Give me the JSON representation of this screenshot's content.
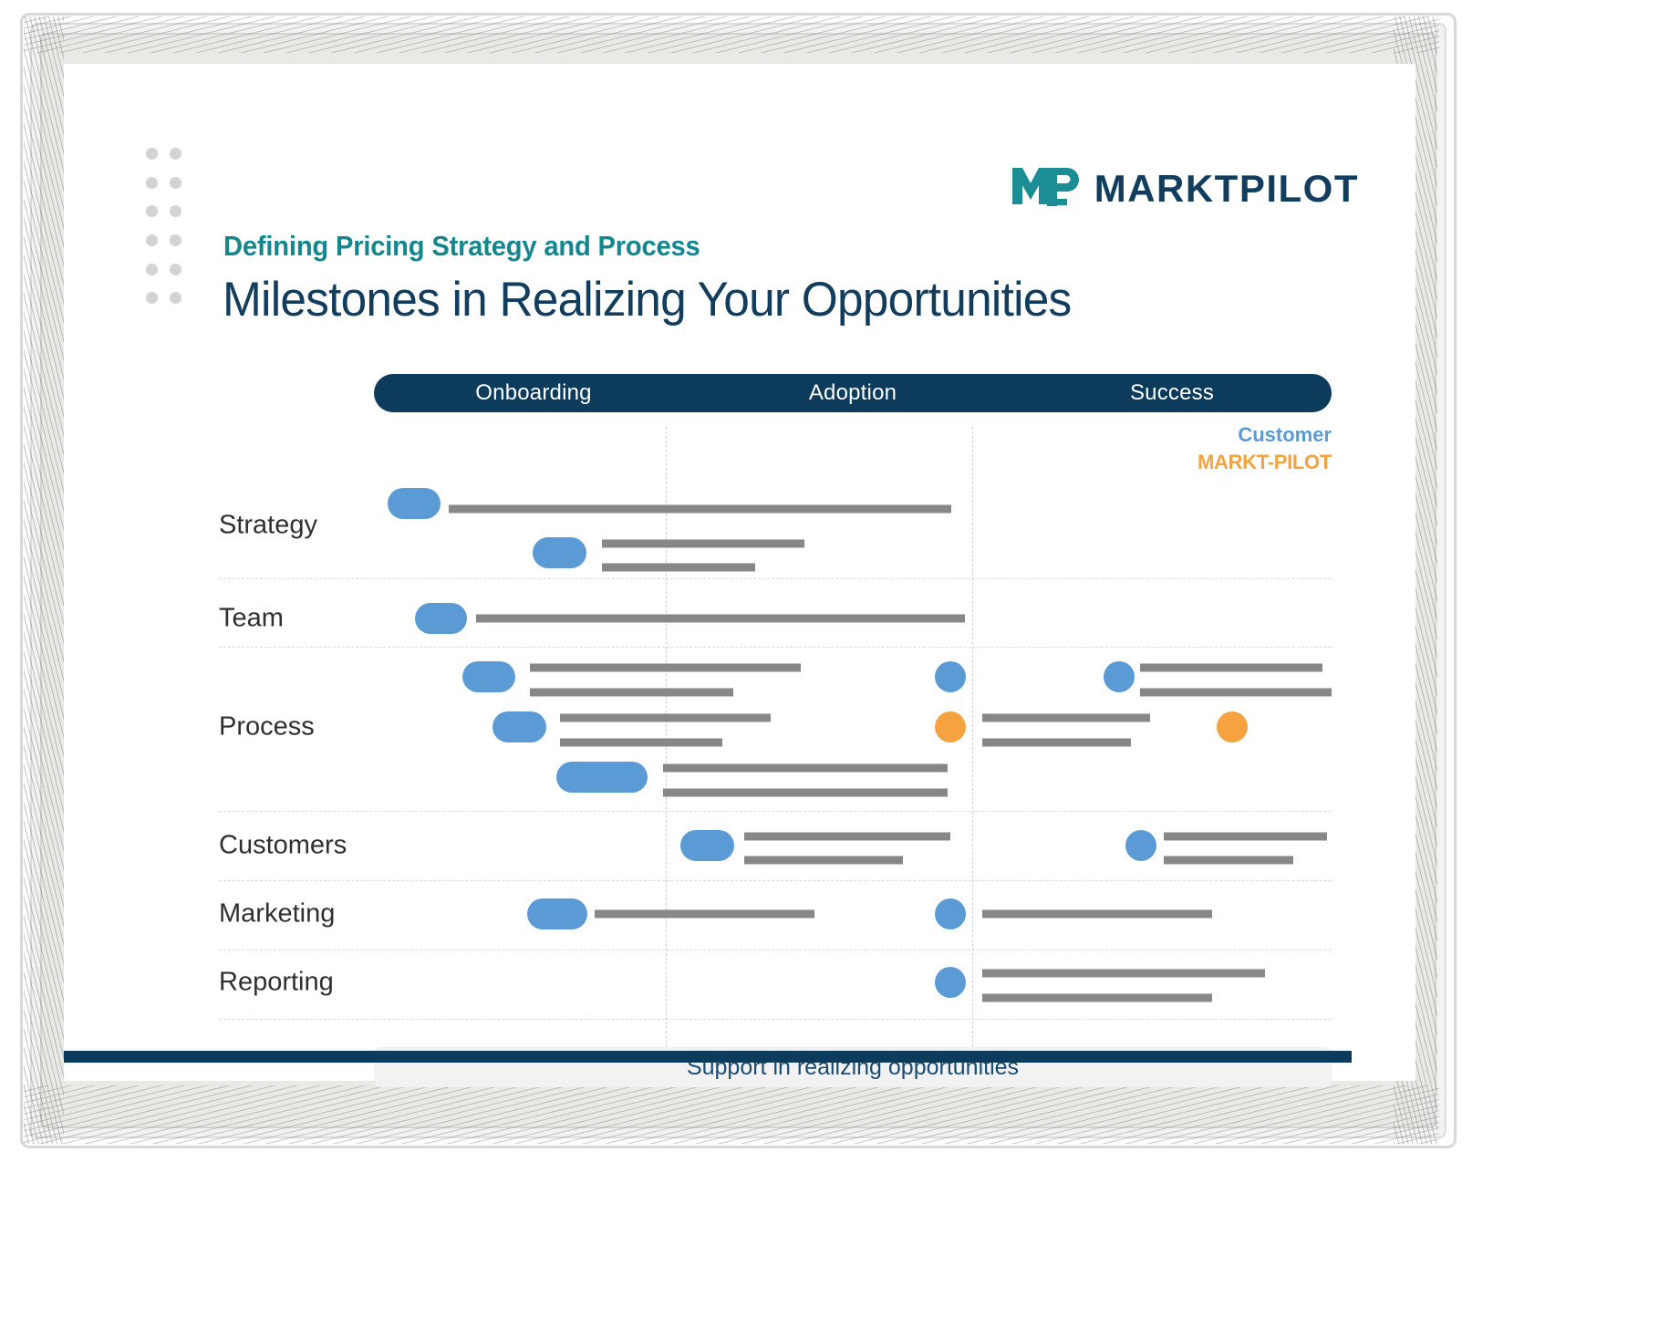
{
  "brand": {
    "logo_mark": "mp-monogram-icon",
    "logo_word": "MARKTPILOT",
    "teal": "#13868e",
    "navy": "#123d5d",
    "blue": "#5b9bd5",
    "orange": "#f5a340",
    "gray_bar": "#878787"
  },
  "header": {
    "eyebrow": "Defining Pricing Strategy and Process",
    "title": "Milestones in Realizing Your Opportunities"
  },
  "phases": [
    {
      "label": "Onboarding"
    },
    {
      "label": "Adoption"
    },
    {
      "label": "Success"
    }
  ],
  "legend": [
    {
      "label": "Customer",
      "color": "#5b9bd5"
    },
    {
      "label": "MARKT-PILOT",
      "color": "#f5a340"
    }
  ],
  "footer": {
    "label": "Support in realizing opportunities"
  },
  "chart_data": {
    "type": "timeline",
    "title": "Milestones in Realizing Your Opportunities",
    "x_axis": {
      "label": "",
      "categories": [
        "Onboarding",
        "Adoption",
        "Success"
      ],
      "phase_boundaries_pct": [
        0,
        30.5,
        62.5,
        100
      ],
      "grid": "dashed"
    },
    "y_axis": {
      "label": "",
      "categories": [
        "Strategy",
        "Team",
        "Process",
        "Customers",
        "Marketing",
        "Reporting"
      ]
    },
    "legend": {
      "position": "top-right",
      "entries": [
        "Customer",
        "MARKT-PILOT"
      ]
    },
    "rows": [
      {
        "category": "Strategy",
        "label_y_pct": 15.7,
        "items": [
          {
            "owner": "Customer",
            "marker": "pill",
            "marker_x_pct": 1.4,
            "marker_w_pct": 5.6,
            "y_pct": 12.2,
            "bars": [
              {
                "x_pct": 7.8,
                "w_pct": 52.5,
                "y_pct": 13.0
              }
            ]
          },
          {
            "owner": "Customer",
            "marker": "pill",
            "marker_x_pct": 16.6,
            "marker_w_pct": 5.6,
            "y_pct": 20.0,
            "bars": [
              {
                "x_pct": 23.8,
                "w_pct": 21.2,
                "y_pct": 18.5
              },
              {
                "x_pct": 23.8,
                "w_pct": 16.0,
                "y_pct": 22.3
              }
            ]
          }
        ]
      },
      {
        "category": "Team",
        "label_y_pct": 30.4,
        "items": [
          {
            "owner": "Customer",
            "marker": "pill",
            "marker_x_pct": 4.3,
            "marker_w_pct": 5.4,
            "y_pct": 30.4,
            "bars": [
              {
                "x_pct": 10.7,
                "w_pct": 51.0,
                "y_pct": 30.4
              }
            ]
          }
        ]
      },
      {
        "category": "Process",
        "label_y_pct": 47.7,
        "items": [
          {
            "owner": "Customer",
            "marker": "pill",
            "marker_x_pct": 9.2,
            "marker_w_pct": 5.6,
            "y_pct": 39.7,
            "bars": [
              {
                "x_pct": 16.3,
                "w_pct": 28.3,
                "y_pct": 38.3
              },
              {
                "x_pct": 16.3,
                "w_pct": 21.2,
                "y_pct": 42.2
              }
            ]
          },
          {
            "owner": "Customer",
            "marker": "dot",
            "marker_x_pct": 58.6,
            "y_pct": 39.7,
            "bars": []
          },
          {
            "owner": "Customer",
            "marker": "dot",
            "marker_x_pct": 76.2,
            "y_pct": 39.7,
            "bars": [
              {
                "x_pct": 80.0,
                "w_pct": 19.0,
                "y_pct": 38.3
              },
              {
                "x_pct": 80.0,
                "w_pct": 20.0,
                "y_pct": 42.2
              }
            ]
          },
          {
            "owner": "Customer",
            "marker": "pill",
            "marker_x_pct": 12.4,
            "marker_w_pct": 5.6,
            "y_pct": 47.7,
            "bars": [
              {
                "x_pct": 19.4,
                "w_pct": 22.0,
                "y_pct": 46.2
              },
              {
                "x_pct": 19.4,
                "w_pct": 17.0,
                "y_pct": 50.1
              }
            ]
          },
          {
            "owner": "MARKT-PILOT",
            "marker": "dot",
            "marker_x_pct": 58.6,
            "y_pct": 47.7,
            "bars": [
              {
                "x_pct": 63.5,
                "w_pct": 17.5,
                "y_pct": 46.2
              },
              {
                "x_pct": 63.5,
                "w_pct": 15.5,
                "y_pct": 50.1
              }
            ]
          },
          {
            "owner": "MARKT-PILOT",
            "marker": "dot",
            "marker_x_pct": 88.0,
            "y_pct": 47.7,
            "bars": []
          },
          {
            "owner": "Customer",
            "marker": "pill",
            "marker_x_pct": 19.0,
            "marker_w_pct": 9.6,
            "y_pct": 55.6,
            "bars": [
              {
                "x_pct": 30.2,
                "w_pct": 29.7,
                "y_pct": 54.2
              },
              {
                "x_pct": 30.2,
                "w_pct": 29.7,
                "y_pct": 58.1
              }
            ]
          }
        ]
      },
      {
        "category": "Customers",
        "label_y_pct": 66.5,
        "items": [
          {
            "owner": "Customer",
            "marker": "pill",
            "marker_x_pct": 32.0,
            "marker_w_pct": 5.6,
            "y_pct": 66.5,
            "bars": [
              {
                "x_pct": 38.7,
                "w_pct": 21.5,
                "y_pct": 65.0
              },
              {
                "x_pct": 38.7,
                "w_pct": 16.5,
                "y_pct": 68.9
              }
            ]
          },
          {
            "owner": "Customer",
            "marker": "dot",
            "marker_x_pct": 78.5,
            "y_pct": 66.5,
            "bars": [
              {
                "x_pct": 82.5,
                "w_pct": 17.0,
                "y_pct": 65.0
              },
              {
                "x_pct": 82.5,
                "w_pct": 13.5,
                "y_pct": 68.9
              }
            ]
          }
        ]
      },
      {
        "category": "Marketing",
        "label_y_pct": 77.4,
        "items": [
          {
            "owner": "Customer",
            "marker": "pill",
            "marker_x_pct": 16.0,
            "marker_w_pct": 6.3,
            "y_pct": 77.4,
            "bars": [
              {
                "x_pct": 23.0,
                "w_pct": 23.0,
                "y_pct": 77.4
              }
            ]
          },
          {
            "owner": "Customer",
            "marker": "dot",
            "marker_x_pct": 58.6,
            "y_pct": 77.4,
            "bars": [
              {
                "x_pct": 63.5,
                "w_pct": 24.0,
                "y_pct": 77.4
              }
            ]
          }
        ]
      },
      {
        "category": "Reporting",
        "label_y_pct": 88.3,
        "items": [
          {
            "owner": "Customer",
            "marker": "dot",
            "marker_x_pct": 58.6,
            "y_pct": 88.3,
            "bars": [
              {
                "x_pct": 63.5,
                "w_pct": 29.5,
                "y_pct": 86.8
              },
              {
                "x_pct": 63.5,
                "w_pct": 24.0,
                "y_pct": 90.7
              }
            ]
          }
        ]
      }
    ],
    "row_separators_pct": [
      24.0,
      34.9,
      61.0,
      72.0,
      83.0,
      94.0
    ]
  }
}
